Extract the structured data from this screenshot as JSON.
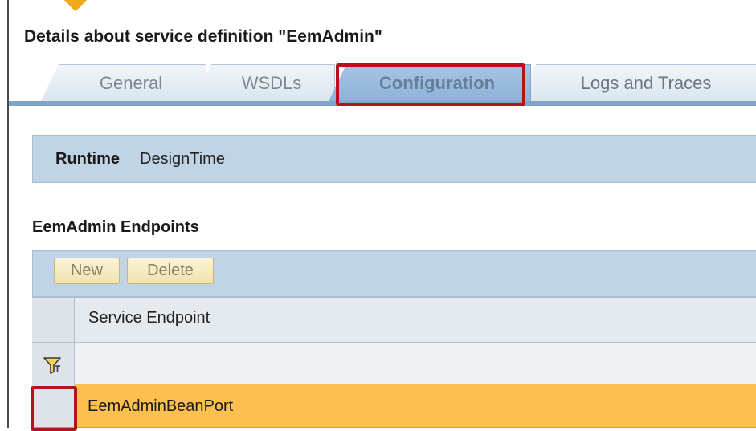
{
  "title": "Details about service definition \"EemAdmin\"",
  "tabs": [
    {
      "label": "General"
    },
    {
      "label": "WSDLs"
    },
    {
      "label": "Configuration",
      "active": true
    },
    {
      "label": "Logs and Traces"
    }
  ],
  "runtime": {
    "label": "Runtime",
    "value": "DesignTime"
  },
  "endpoints": {
    "title": "EemAdmin Endpoints",
    "toolbar": {
      "new_label": "New",
      "delete_label": "Delete"
    },
    "columns": [
      "Service Endpoint"
    ],
    "rows": [
      {
        "service_endpoint": "EemAdminBeanPort",
        "selected": true
      }
    ]
  },
  "colors": {
    "highlight_border": "#b5121b",
    "selected_row": "#fbc04f",
    "panel_blue": "#c1d4e6",
    "accent_marker": "#f2a81d"
  },
  "icons": {
    "filter": "filter-icon"
  }
}
